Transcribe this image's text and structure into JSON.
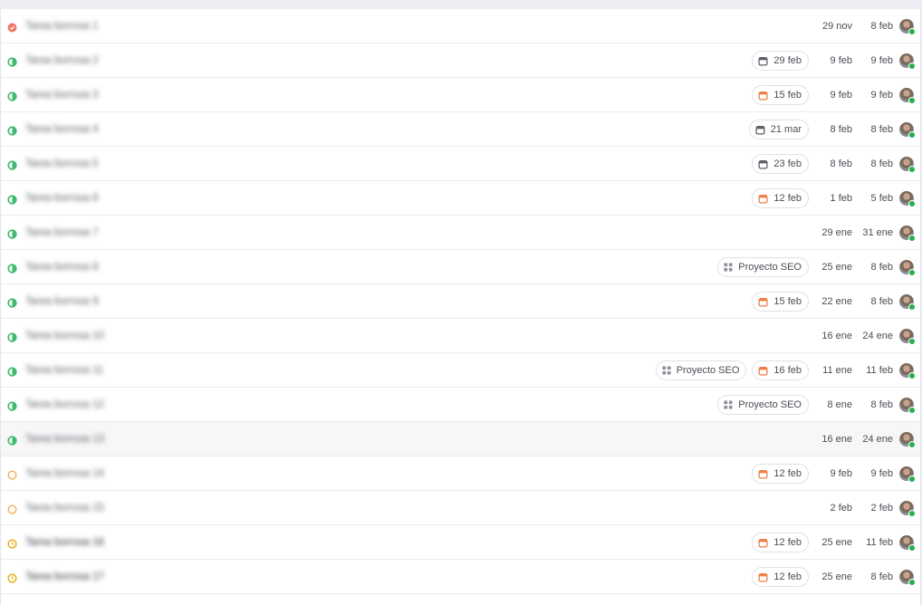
{
  "colors": {
    "status_red": "#f07766",
    "status_green": "#3fba6e",
    "status_orange": "#f4b76a",
    "status_yellow": "#e7b52a",
    "due_overdue": "#ef7f46",
    "due_neutral": "#5c6068"
  },
  "rows": [
    {
      "title": "Tarea borrosa 1",
      "status": "red",
      "icon": "status-icon",
      "chip_due": "",
      "due_color": "",
      "chip_project": "",
      "created": "29 nov",
      "updated": "8 feb"
    },
    {
      "title": "Tarea borrosa 2",
      "status": "green",
      "icon": "status-icon",
      "chip_due": "29 feb",
      "due_color": "neutral",
      "chip_project": "",
      "created": "9 feb",
      "updated": "9 feb"
    },
    {
      "title": "Tarea borrosa 3",
      "status": "green",
      "icon": "status-icon",
      "chip_due": "15 feb",
      "due_color": "overdue",
      "chip_project": "",
      "created": "9 feb",
      "updated": "9 feb"
    },
    {
      "title": "Tarea borrosa 4",
      "status": "green",
      "icon": "status-icon",
      "chip_due": "21 mar",
      "due_color": "neutral",
      "chip_project": "",
      "created": "8 feb",
      "updated": "8 feb"
    },
    {
      "title": "Tarea borrosa 5",
      "status": "green",
      "icon": "status-icon",
      "chip_due": "23 feb",
      "due_color": "neutral",
      "chip_project": "",
      "created": "8 feb",
      "updated": "8 feb"
    },
    {
      "title": "Tarea borrosa 6",
      "status": "green",
      "icon": "status-icon",
      "chip_due": "12 feb",
      "due_color": "overdue",
      "chip_project": "",
      "created": "1 feb",
      "updated": "5 feb"
    },
    {
      "title": "Tarea borrosa 7",
      "status": "green",
      "icon": "status-icon",
      "chip_due": "",
      "due_color": "",
      "chip_project": "",
      "created": "29 ene",
      "updated": "31 ene"
    },
    {
      "title": "Tarea borrosa 8",
      "status": "green",
      "icon": "status-icon",
      "chip_due": "",
      "due_color": "",
      "chip_project": "Proyecto SEO",
      "created": "25 ene",
      "updated": "8 feb"
    },
    {
      "title": "Tarea borrosa 9",
      "status": "green",
      "icon": "status-icon",
      "chip_due": "15 feb",
      "due_color": "overdue",
      "chip_project": "",
      "created": "22 ene",
      "updated": "8 feb"
    },
    {
      "title": "Tarea borrosa 10",
      "status": "green",
      "icon": "status-icon",
      "chip_due": "",
      "due_color": "",
      "chip_project": "",
      "created": "16 ene",
      "updated": "24 ene"
    },
    {
      "title": "Tarea borrosa 11",
      "status": "green",
      "icon": "status-icon",
      "chip_due": "16 feb",
      "due_color": "overdue",
      "chip_project": "Proyecto SEO",
      "created": "11 ene",
      "updated": "11 feb"
    },
    {
      "title": "Tarea borrosa 12",
      "status": "green",
      "icon": "status-icon",
      "chip_due": "",
      "due_color": "",
      "chip_project": "Proyecto SEO",
      "created": "8 ene",
      "updated": "8 feb"
    },
    {
      "title": "Tarea borrosa 13",
      "status": "green",
      "icon": "status-icon",
      "chip_due": "",
      "due_color": "",
      "chip_project": "",
      "created": "16 ene",
      "updated": "24 ene"
    },
    {
      "title": "Tarea borrosa 14",
      "status": "orange",
      "icon": "status-icon",
      "chip_due": "12 feb",
      "due_color": "overdue",
      "chip_project": "",
      "created": "9 feb",
      "updated": "9 feb"
    },
    {
      "title": "Tarea borrosa 15",
      "status": "orange",
      "icon": "status-icon",
      "chip_due": "",
      "due_color": "",
      "chip_project": "",
      "created": "2 feb",
      "updated": "2 feb"
    },
    {
      "title": "Tarea borrosa 16",
      "status": "yellow",
      "icon": "status-icon",
      "chip_due": "12 feb",
      "due_color": "overdue",
      "chip_project": "",
      "created": "25 ene",
      "updated": "11 feb"
    },
    {
      "title": "Tarea borrosa 17",
      "status": "yellow",
      "icon": "status-icon",
      "chip_due": "12 feb",
      "due_color": "overdue",
      "chip_project": "",
      "created": "25 ene",
      "updated": "8 feb"
    }
  ]
}
